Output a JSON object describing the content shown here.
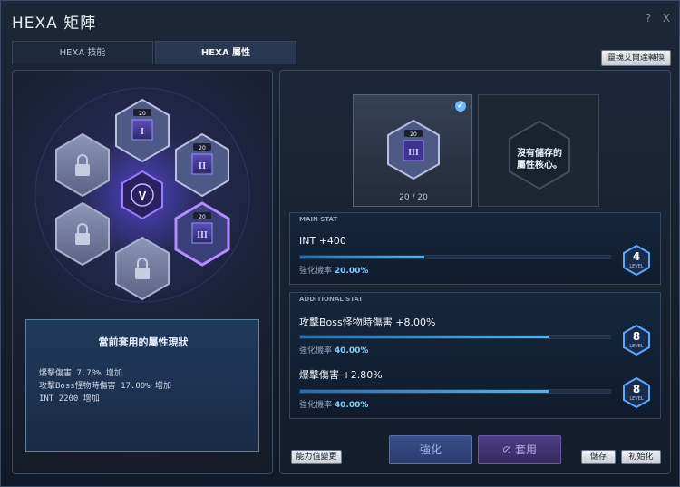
{
  "window": {
    "title": "HEXA 矩陣",
    "help_label": "?",
    "close_label": "X"
  },
  "tabs": [
    {
      "label": "HEXA 技能"
    },
    {
      "label": "HEXA 屬性"
    }
  ],
  "top_right_button": "靈魂艾爾達轉換",
  "left": {
    "center_emblem": "V",
    "nodes": [
      {
        "label": "I",
        "level": "20"
      },
      {
        "label": "II",
        "level": "20"
      },
      {
        "label": "III",
        "level": "20"
      }
    ],
    "status": {
      "title": "當前套用的屬性現狀",
      "lines": [
        "爆擊傷害 7.70% 增加",
        "攻擊Boss怪物時傷害 17.00% 增加",
        "INT 2200 增加"
      ]
    }
  },
  "right": {
    "selected_core": {
      "label": "III",
      "level": "20",
      "count": "20 / 20"
    },
    "empty_core_text": [
      "沒有儲存的",
      "屬性核心。"
    ],
    "main_stat": {
      "header": "MAIN STAT",
      "text": "INT +400",
      "rate_label": "強化機率",
      "rate_value": "20.00%",
      "progress": 0.4,
      "level": "4",
      "level_label": "LEVEL"
    },
    "additional_stat": {
      "header": "ADDITIONAL STAT",
      "items": [
        {
          "text": "攻擊Boss怪物時傷害 +8.00%",
          "rate_label": "強化機率",
          "rate_value": "40.00%",
          "progress": 0.8,
          "level": "8",
          "level_label": "LEVEL"
        },
        {
          "text": "爆擊傷害 +2.80%",
          "rate_label": "強化機率",
          "rate_value": "40.00%",
          "progress": 0.8,
          "level": "8",
          "level_label": "LEVEL"
        }
      ]
    },
    "buttons": {
      "stat_change": "能力值變更",
      "enhance": "強化",
      "apply": "套用",
      "save": "儲存",
      "reset": "初始化"
    }
  },
  "colors": {
    "accent": "#8a5cff",
    "bar": "#5fb0e8"
  }
}
